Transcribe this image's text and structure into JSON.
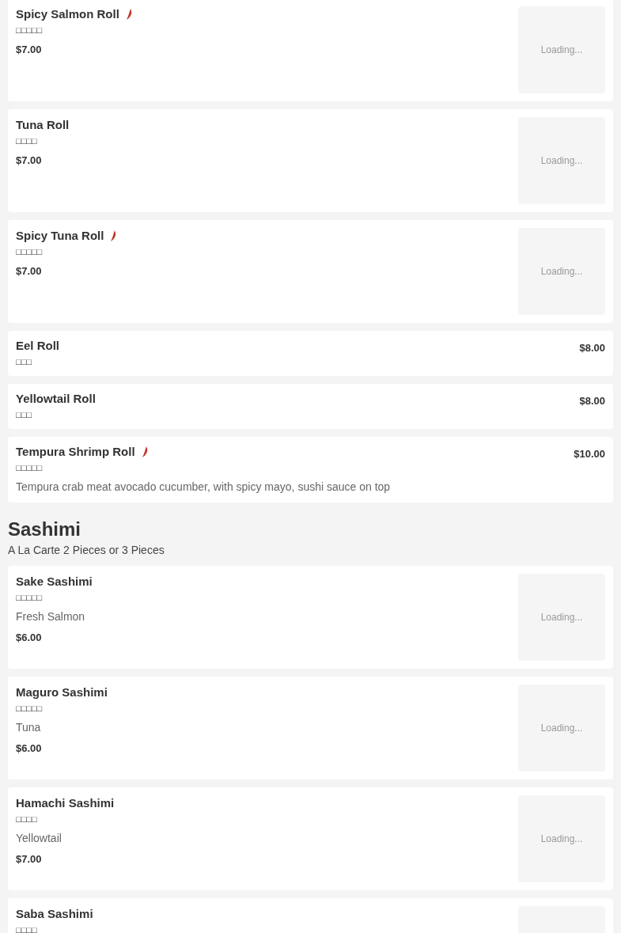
{
  "sections": [
    {
      "items": [
        {
          "kind": "image",
          "name": "Spicy Salmon Roll",
          "spicy": true,
          "native": "□□□□□",
          "price": "$7.00",
          "image_text": "Loading..."
        },
        {
          "kind": "image",
          "name": "Tuna Roll",
          "spicy": false,
          "native": "□□□□",
          "price": "$7.00",
          "image_text": "Loading..."
        },
        {
          "kind": "image",
          "name": "Spicy Tuna Roll",
          "spicy": true,
          "native": "□□□□□",
          "price": "$7.00",
          "image_text": "Loading..."
        },
        {
          "kind": "plain",
          "name": "Eel Roll",
          "spicy": false,
          "native": "□□□",
          "price": "$8.00"
        },
        {
          "kind": "plain",
          "name": "Yellowtail Roll",
          "spicy": false,
          "native": "□□□",
          "price": "$8.00"
        },
        {
          "kind": "plain",
          "name": "Tempura Shrimp Roll",
          "spicy": true,
          "native": "□□□□□",
          "description": "Tempura crab meat avocado cucumber, with spicy mayo, sushi sauce on top",
          "price": "$10.00"
        }
      ]
    },
    {
      "title": "Sashimi",
      "subtitle": "A La Carte 2 Pieces or 3 Pieces",
      "items": [
        {
          "kind": "image",
          "name": "Sake Sashimi",
          "spicy": false,
          "native": "□□□□□",
          "description": "Fresh Salmon",
          "price": "$6.00",
          "image_text": "Loading..."
        },
        {
          "kind": "image",
          "name": "Maguro Sashimi",
          "spicy": false,
          "native": "□□□□□",
          "description": "Tuna",
          "price": "$6.00",
          "image_text": "Loading..."
        },
        {
          "kind": "image",
          "name": "Hamachi Sashimi",
          "spicy": false,
          "native": "□□□□",
          "description": "Yellowtail",
          "price": "$7.00",
          "image_text": "Loading..."
        },
        {
          "kind": "image",
          "name": "Saba Sashimi",
          "spicy": false,
          "native": "□□□□"
        }
      ]
    }
  ]
}
